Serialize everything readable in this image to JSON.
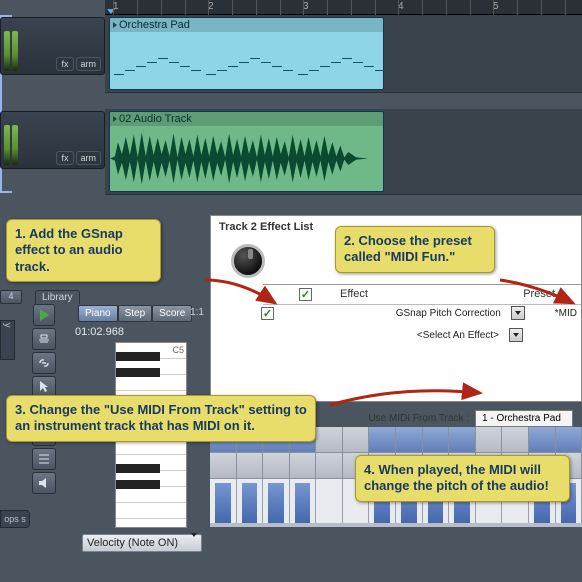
{
  "ruler": {
    "numbers": [
      "1",
      "2",
      "3",
      "4",
      "5"
    ]
  },
  "track_heads": {
    "buttons": [
      "fx",
      "arm"
    ]
  },
  "timeline": {
    "tracks": [
      {
        "name": "Orchestra Pad",
        "type": "midi"
      },
      {
        "name": "02 Audio Track",
        "type": "audio"
      }
    ]
  },
  "left": {
    "tab": "Library",
    "modes": [
      "Piano",
      "Step",
      "Score"
    ],
    "time": "01:02.968",
    "ratio": "1:1",
    "octave": "C5",
    "velocity_sel": "Velocity (Note ON)",
    "loops_label": "ops\ns",
    "side_tab": "y",
    "num4": "4"
  },
  "fx": {
    "title": "Track 2 Effect List",
    "header_effect": "Effect",
    "header_preset": "Preset",
    "rows": [
      {
        "name": "GSnap Pitch Correction",
        "preset": "*MID",
        "checked": true
      },
      {
        "name": "<Select An Effect>",
        "preset": "",
        "checked": false
      }
    ],
    "midi_from_label": "Use MIDI From Track :",
    "midi_from_value": "1 - Orchestra Pad"
  },
  "callouts": {
    "c1": "1. Add the GSnap effect to an audio track.",
    "c2": "2. Choose the preset called \"MIDI Fun.\"",
    "c3": "3. Change the \"Use MIDI From Track\" setting to an instrument track that has MIDI on it.",
    "c4": "4. When played, the MIDI will change the pitch of the audio!"
  },
  "velocity_bars": [
    40,
    40,
    40,
    40,
    0,
    0,
    40,
    40,
    40,
    40,
    0,
    0,
    40,
    40
  ]
}
